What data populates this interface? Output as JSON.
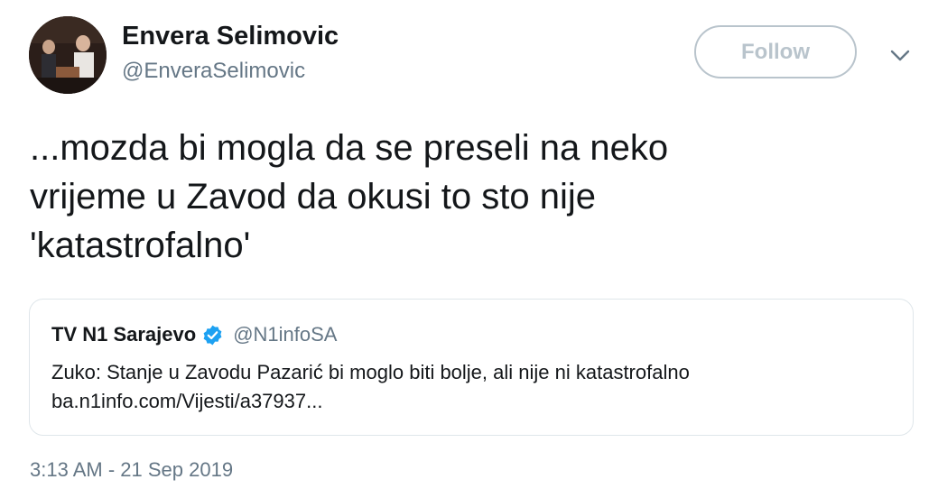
{
  "author": {
    "name": "Envera Selimovic",
    "handle": "@EnveraSelimovic",
    "avatar_icon": "profile-photo"
  },
  "follow": {
    "label": "Follow"
  },
  "menu": {
    "icon": "chevron-down-icon"
  },
  "tweet": {
    "lines": [
      "...mozda bi mogla da se preseli na neko",
      "vrijeme u Zavod da okusi to sto nije",
      "'katastrofalno'"
    ]
  },
  "quoted_tweet": {
    "name": "TV N1 Sarajevo",
    "verified_icon": "verified-badge-icon",
    "handle": "@N1infoSA",
    "text": "Zuko: Stanje u Zavodu Pazarić bi moglo biti bolje, ali nije ni katastrofalno",
    "link": "ba.n1info.com/Vijesti/a37937..."
  },
  "timestamp": "3:13 AM - 21 Sep 2019",
  "colors": {
    "text": "#14171a",
    "secondary": "#657786",
    "follow_border": "#b9c4cc",
    "verified": "#1da1f2",
    "card_border": "#dfe6ea"
  }
}
